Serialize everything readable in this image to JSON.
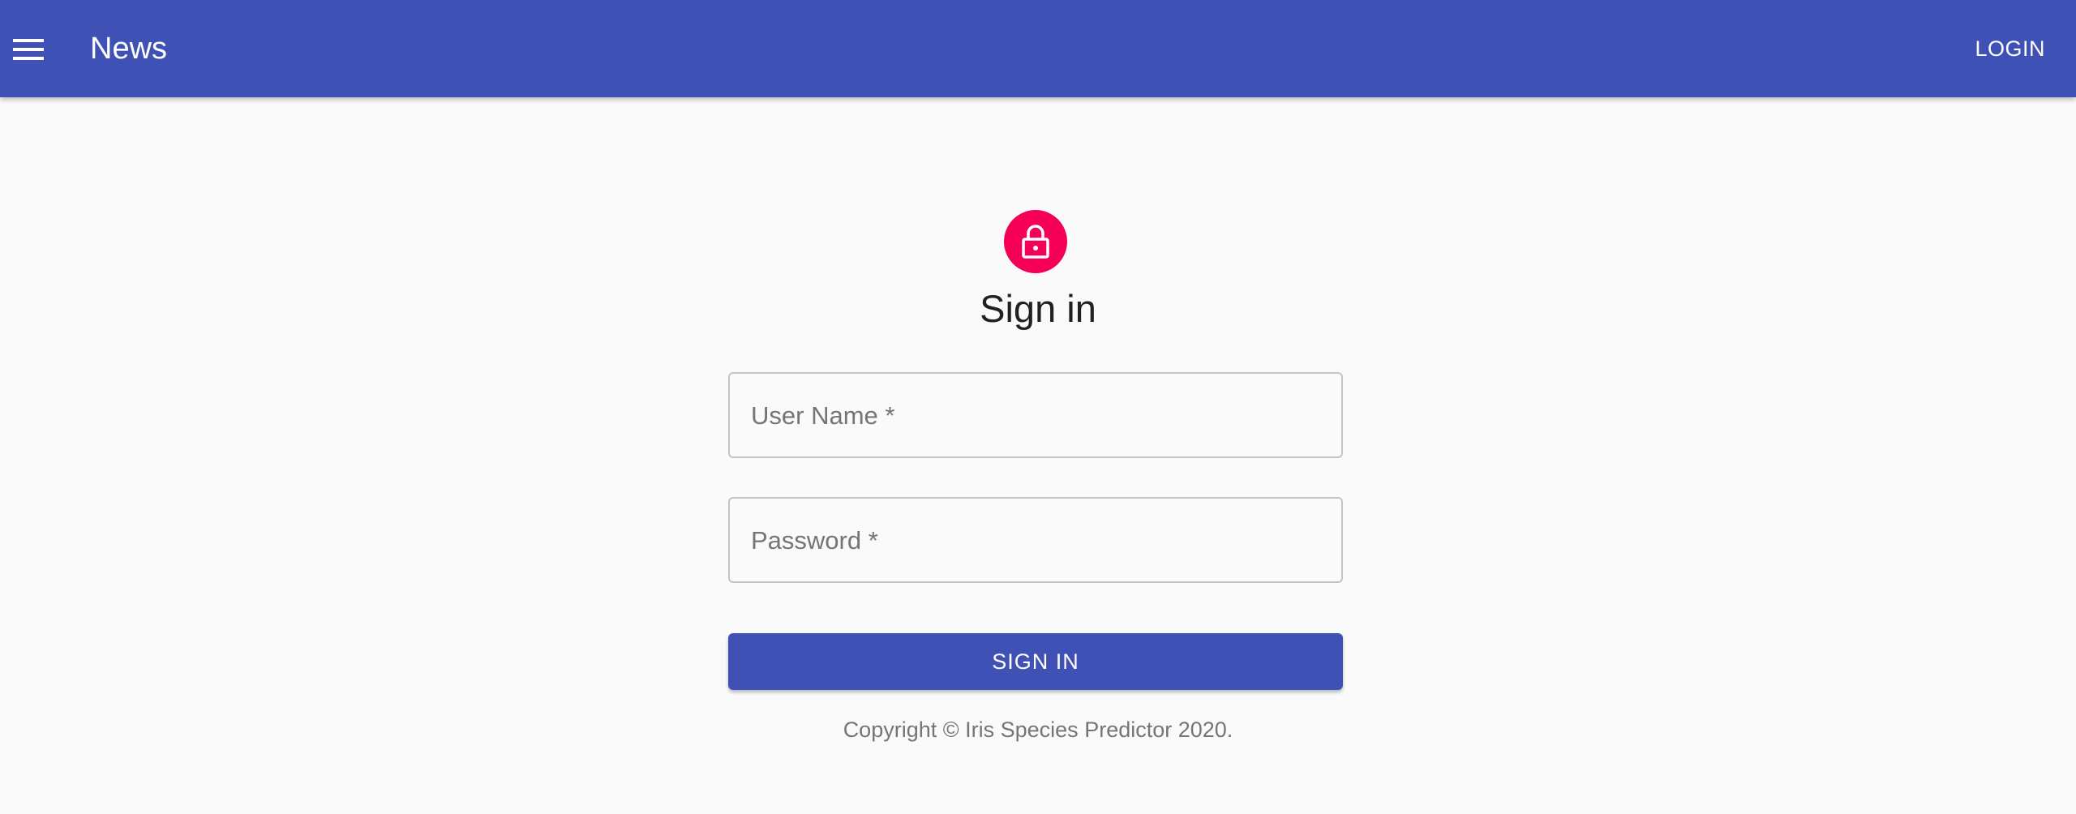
{
  "appbar": {
    "menu_icon": "menu-icon",
    "title": "News",
    "login_label": "LOGIN",
    "color": "#3f51b5"
  },
  "signin": {
    "avatar_icon": "lock-icon",
    "avatar_color": "#f50057",
    "heading": "Sign in",
    "username_label": "User Name *",
    "username_value": "",
    "password_label": "Password *",
    "password_value": "",
    "submit_label": "SIGN IN"
  },
  "footer": {
    "copyright": "Copyright © Iris Species Predictor 2020."
  }
}
